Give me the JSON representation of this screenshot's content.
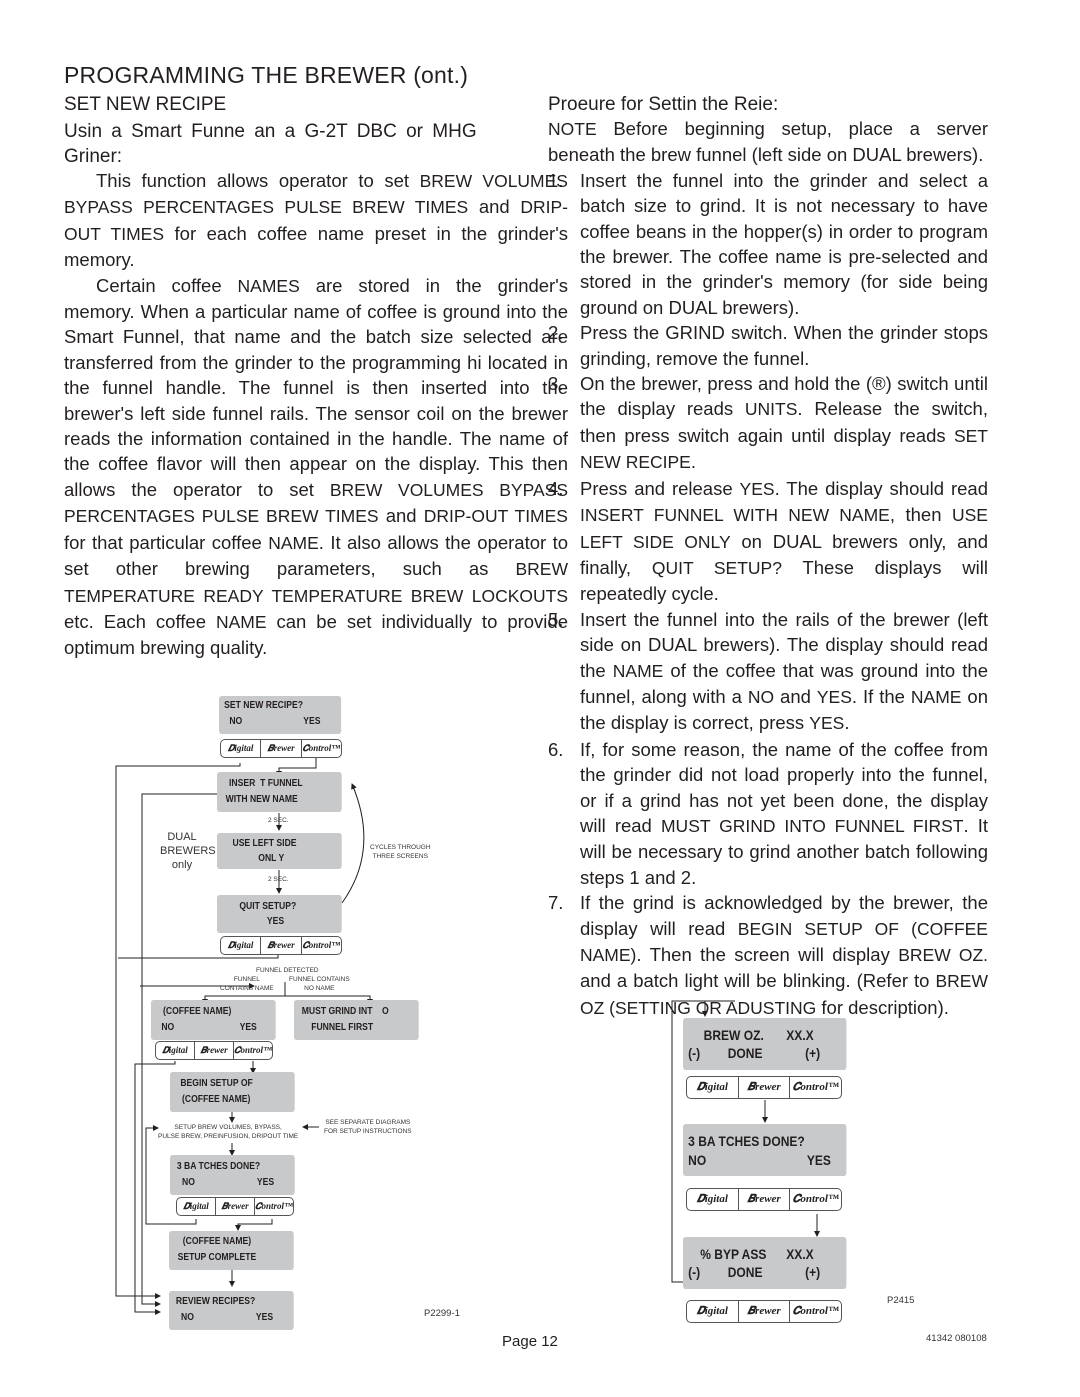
{
  "page": {
    "title": "PROGRAMMING THE BREWER (ont.)",
    "section_heading": "SET NEW RECIPE",
    "subheading": "Usin a Smart Funne an a G-2T DBC or MHG Griner:",
    "page_number": "Page 12",
    "doc_code": "41342 080108"
  },
  "left_text": {
    "p1": [
      {
        "t": "This function allows operator to set ",
        "caps": false
      },
      {
        "t": "BREW VOLUMES BYPASS PERCENTAGES PULSE BREW TIMES",
        "caps": true
      },
      {
        "t": " and ",
        "caps": false
      },
      {
        "t": "DRIP-OUT TIMES",
        "caps": true
      },
      {
        "t": " for each coffee name preset in the grinder's memory.",
        "caps": false
      }
    ],
    "p2": [
      {
        "t": "Certain coffee ",
        "caps": false
      },
      {
        "t": "NAMES",
        "caps": true
      },
      {
        "t": " are stored in the grinder's memory. When a particular name of coffee is ground into the Smart Funnel, that name and the batch size selected are transferred from the grinder to the programming hi    located in the funnel handle. The funnel is then inserted into the brewer's left side funnel rails. The sensor coil on the brewer reads the information contained in the handle. The name of the coffee flavor will then appear on the display. This then allows the operator to set ",
        "caps": false
      },
      {
        "t": "BREW VOLUMES BYPASS PERCENTAGES PULSE BREW TIMES",
        "caps": true
      },
      {
        "t": " and ",
        "caps": false
      },
      {
        "t": "DRIP-OUT TIMES",
        "caps": true
      },
      {
        "t": " for that particular coffee ",
        "caps": false
      },
      {
        "t": "NAME",
        "caps": true
      },
      {
        "t": ". It also allows the operator to set other brewing parameters, such as ",
        "caps": false
      },
      {
        "t": "BREW TEMPERATURE READY TEMPERATURE BREW LOCKOUTS",
        "caps": true
      },
      {
        "t": " etc. Each coffee ",
        "caps": false
      },
      {
        "t": "NAME",
        "caps": true
      },
      {
        "t": " can be set individually to provide optimum brewing quality.",
        "caps": false
      }
    ]
  },
  "right_text": {
    "heading": "Proeure for Settin the Reie:",
    "note": [
      {
        "t": "NOTE",
        "caps": true
      },
      {
        "t": " Before beginning setup, place a server beneath the brew funnel (left side on DUAL brewers).",
        "caps": false
      }
    ],
    "steps": [
      {
        "num": "1.",
        "parts": [
          {
            "t": "Insert the funnel into the grinder and select a batch size to grind. It is not necessary to have coffee beans in the hopper(s) in order to program the brewer. The coffee name is pre-selected and stored in the grinder's memory (for side being ground on DUAL brewers).",
            "caps": false
          }
        ]
      },
      {
        "num": "2.",
        "parts": [
          {
            "t": "Press the GRIND switch. When the grinder stops grinding, remove the funnel.",
            "caps": false
          }
        ]
      },
      {
        "num": "3.",
        "parts": [
          {
            "t": "On the brewer, press and hold the (®) switch until the display reads ",
            "caps": false
          },
          {
            "t": "UNITS",
            "caps": true
          },
          {
            "t": ". Release the switch, then press switch again until display reads ",
            "caps": false
          },
          {
            "t": "SET NEW RECIPE",
            "caps": true
          },
          {
            "t": ".",
            "caps": false
          }
        ]
      },
      {
        "num": "4.",
        "parts": [
          {
            "t": "Press and release ",
            "caps": false
          },
          {
            "t": "YES",
            "caps": true
          },
          {
            "t": ". The display should read ",
            "caps": false
          },
          {
            "t": "INSERT FUNNEL WITH NEW NAME",
            "caps": true
          },
          {
            "t": ", then ",
            "caps": false
          },
          {
            "t": "USE LEFT SIDE ONLY",
            "caps": true
          },
          {
            "t": " on DUAL brewers only, and finally, ",
            "caps": false
          },
          {
            "t": "QUIT SETUP?",
            "caps": true
          },
          {
            "t": " These displays will repeatedly cycle.",
            "caps": false
          }
        ]
      },
      {
        "num": "5.",
        "parts": [
          {
            "t": "Insert the funnel into the rails of the brewer (left side on DUAL brewers). The display should read the ",
            "caps": false
          },
          {
            "t": "NAME",
            "caps": true
          },
          {
            "t": " of the coffee that was ground into the funnel, along with a ",
            "caps": false
          },
          {
            "t": "NO",
            "caps": true
          },
          {
            "t": " and ",
            "caps": false
          },
          {
            "t": "YES",
            "caps": true
          },
          {
            "t": ". If the ",
            "caps": false
          },
          {
            "t": "NAME",
            "caps": true
          },
          {
            "t": " on the display is correct, press ",
            "caps": false
          },
          {
            "t": "YES",
            "caps": true
          },
          {
            "t": ".",
            "caps": false
          }
        ]
      },
      {
        "num": "6.",
        "parts": [
          {
            "t": "If, for some reason, the name of the coffee from the grinder did not load properly into the funnel, or if a grind has not yet been done, the display will read ",
            "caps": false
          },
          {
            "t": "MUST GRIND INTO FUNNEL FIRST",
            "caps": true
          },
          {
            "t": ". It will be necessary to grind another batch following steps 1 and 2.",
            "caps": false
          }
        ]
      },
      {
        "num": "7.",
        "parts": [
          {
            "t": "If the grind is acknowledged by the brewer, the display will read ",
            "caps": false
          },
          {
            "t": "BEGIN SETUP OF (COFFEE NAME)",
            "caps": true
          },
          {
            "t": ". Then the screen will display ",
            "caps": false
          },
          {
            "t": "BREW OZ.",
            "caps": true
          },
          {
            "t": " and a batch light will be blinking. (Refer to ",
            "caps": false
          },
          {
            "t": "BREW OZ (SETTING OR ADUSTING",
            "caps": true
          },
          {
            "t": " for description).",
            "caps": false
          }
        ]
      }
    ]
  },
  "diagram_left": {
    "figure_id": "P2299-1",
    "dbc_labels": [
      "Digital",
      "Brewer",
      "Control"
    ],
    "screens": {
      "set_new_recipe": {
        "line1": "SET NEW RECIPE?",
        "no": "NO",
        "yes": "YES"
      },
      "insert_funnel": {
        "line1": "INSER  T FUNNEL",
        "line2": "WITH NEW NAME"
      },
      "use_left_side": {
        "line1": "USE LEFT SIDE",
        "line2": "ONL Y"
      },
      "quit_setup": {
        "line1": "QUIT SETUP?",
        "line2": "YES"
      },
      "coffee_name": {
        "line1": "(COFFEE NAME)",
        "no": "NO",
        "yes": "YES"
      },
      "must_grind": {
        "line1": "MUST GRIND INT    O",
        "line2": "FUNNEL FIRST"
      },
      "begin_setup": {
        "line1": "BEGIN SETUP OF",
        "line2": "(COFFEE NAME)"
      },
      "batches_done": {
        "line1": "3 BA TCHES DONE?",
        "no": "NO",
        "yes": "YES"
      },
      "setup_complete": {
        "line1": "(COFFEE NAME)",
        "line2": "SETUP COMPLETE"
      },
      "review_recipes": {
        "line1": "REVIEW RECIPES?",
        "no": "NO",
        "yes": "YES"
      }
    },
    "labels": {
      "two_sec_a": "2 SEC.",
      "two_sec_b": "2 SEC.",
      "dual_brewers": "DUAL\nBREWERS\nonly",
      "cycles": "CYCLES THROUGH\nTHREE SCREENS",
      "funnel_detected": "FUNNEL DETECTED",
      "contains_name": "FUNNEL\nCONTAINS NAME",
      "contains_no_name": "FUNNEL CONTAINS\nNO NAME",
      "setup_brew": "SETUP BREW VOLUMES, BYPASS,\nPULSE BREW, PREINFUSION, DRIPOUT TIME",
      "see_separate": "SEE SEPARATE DIAGRAMS\nFOR SETUP INSTRUCTIONS"
    }
  },
  "diagram_right": {
    "figure_id": "P2415",
    "screens": {
      "brew_oz": {
        "label": "BREW OZ.",
        "value": "XX.X",
        "minus": "(-)",
        "done": "DONE",
        "plus": "(+)"
      },
      "batches_done": {
        "line1": "3 BA TCHES DONE?",
        "no": "NO",
        "yes": "YES"
      },
      "bypass": {
        "label": "% BYP ASS",
        "value": "XX.X",
        "minus": "(-)",
        "done": "DONE",
        "plus": "(+)"
      }
    }
  }
}
